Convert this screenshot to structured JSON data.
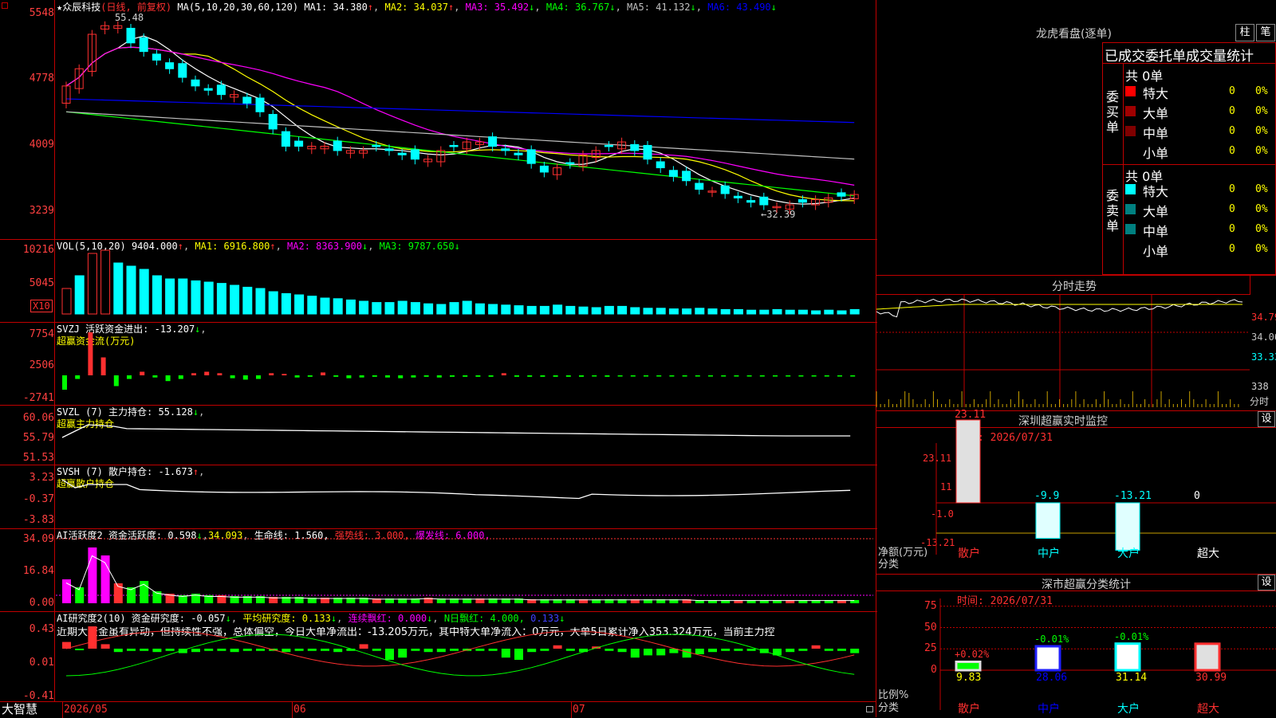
{
  "colors": {
    "bg": "#000000",
    "grid": "#c00000",
    "up": "#ff3030",
    "down": "#00ffff",
    "ma1": "#ffffff",
    "ma2": "#ffff00",
    "ma3": "#ff00ff",
    "ma4": "#00ff00",
    "ma5": "#c0c0c0",
    "ma6": "#0000ff"
  },
  "main": {
    "stock_title": "★众辰科技",
    "period": "(日线, 前复权)",
    "ma_params": "MA(5,10,20,30,60,120)",
    "ma1": "MA1: 34.380",
    "ma2": "MA2: 34.037",
    "ma3": "MA3: 35.492",
    "ma4": "MA4: 36.767",
    "ma5": "MA5: 41.132",
    "ma6": "MA6: 43.490",
    "y_ticks": [
      "5548",
      "4778",
      "4009",
      "3239"
    ],
    "high_label": "55.48",
    "low_label": "←32.39"
  },
  "vol": {
    "title": "VOL(5,10,20)",
    "value": "9404.000",
    "ma1": "MA1: 6916.800",
    "ma2": "MA2: 8363.900",
    "ma3": "MA3: 9787.650",
    "y_ticks": [
      "10216",
      "5045"
    ],
    "unit": "X10"
  },
  "svzj": {
    "title": "SVZJ  活跃资金进出:",
    "value": "-13.207",
    "subtitle": "超赢资金流(万元)",
    "y_ticks": [
      "7754",
      "2506",
      "-2741"
    ]
  },
  "svzl": {
    "title": "SVZL (7) 主力持仓:",
    "value": "55.128",
    "subtitle": "超赢主力持仓",
    "y_ticks": [
      "60.06",
      "55.79",
      "51.53"
    ]
  },
  "svsh": {
    "title": "SVSH (7) 散户持仓:",
    "value": "-1.673",
    "subtitle": "超赢散户持仓",
    "y_ticks": [
      "3.23",
      "-0.37",
      "-3.83"
    ]
  },
  "ai1": {
    "title": "AI活跃度2 资金活跃度:",
    "value": "0.598",
    "v2": "34.093",
    "life": "生命线: 1.560,",
    "strong": "强势线: 3.000,",
    "burst": "爆发线: 6.000,",
    "y_ticks": [
      "34.09",
      "16.84",
      "0.00"
    ]
  },
  "ai2": {
    "title": "AI研究度2(10) 资金研究度:",
    "value": "-0.057",
    "avg": "平均研究度: 0.133",
    "red": "连续飘红: 0.000",
    "nred": "N日飘红: 4.000,",
    "blue": "0.133",
    "comment": "近期大资金虽有异动，但持续性不强，总体偏空，今日大单净流出：-13.205万元，其中特大单净流入：0万元，大单5日累计净入353.324万元，当前主力控",
    "y_ticks": [
      "0.43",
      "0.01",
      "-0.41"
    ]
  },
  "xaxis": {
    "brand": "大智慧",
    "labels": [
      "2026/05",
      "06",
      "07"
    ]
  },
  "right": {
    "lhb_title": "龙虎看盘(逐单)",
    "btn_zhu": "柱",
    "btn_bi": "笔",
    "stat_title": "已成交委托单成交量统计",
    "buy_label": "委买单",
    "sell_label": "委卖单",
    "buy_total": "共 0单",
    "sell_total": "共 0单",
    "buy_rows": [
      {
        "name": "特大",
        "v": "0",
        "p": "0%",
        "c": "#ff0000"
      },
      {
        "name": "大单",
        "v": "0",
        "p": "0%",
        "c": "#a00000"
      },
      {
        "name": "中单",
        "v": "0",
        "p": "0%",
        "c": "#800000"
      },
      {
        "name": "小单",
        "v": "0",
        "p": "0%",
        "c": ""
      }
    ],
    "sell_rows": [
      {
        "name": "特大",
        "v": "0",
        "p": "0%",
        "c": "#00ffff"
      },
      {
        "name": "大单",
        "v": "0",
        "p": "0%",
        "c": "#008080"
      },
      {
        "name": "中单",
        "v": "0",
        "p": "0%",
        "c": "#008080"
      },
      {
        "name": "小单",
        "v": "0",
        "p": "0%",
        "c": ""
      }
    ],
    "fs_title": "分时走势",
    "fs_y": [
      "34.79",
      "34.06",
      "33.33"
    ],
    "fs_vol": "338",
    "fs_vol_unit": "分时",
    "sz_title": "深圳超赢实时监控",
    "sz_set": "设",
    "sz_time": "时间: 2026/07/31",
    "sz_y": [
      "23.11",
      "11",
      "-1.0",
      "-13.21"
    ],
    "sz_vals": [
      "23.11",
      "-9.9",
      "-13.21",
      "0"
    ],
    "sz_unit": "净额(万元)",
    "sz_cat_label": "分类",
    "cats": [
      "散户",
      "中户",
      "大户",
      "超大"
    ],
    "sc_title": "深市超赢分类统计",
    "sc_set": "设",
    "sc_time": "时间: 2026/07/31",
    "sc_y": [
      "75",
      "50",
      "25",
      "0"
    ],
    "sc_pct": [
      "+0.02%",
      "-0.01%",
      "-0.01%"
    ],
    "sc_vals": [
      "9.83",
      "28.06",
      "31.14",
      "30.99"
    ],
    "sc_unit": "比例%",
    "sc_cat_label": "分类"
  }
}
